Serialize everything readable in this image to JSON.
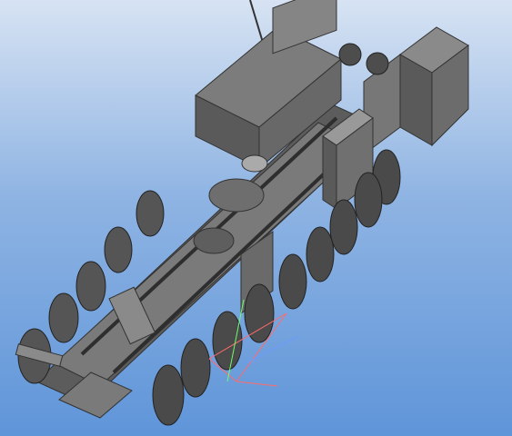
{
  "viewport": {
    "background_top": "#d7e3f3",
    "background_bottom": "#5f95d9"
  },
  "model": {
    "body_color": "#6e6e6e",
    "dark_color": "#3d3d3d",
    "light_color": "#b5b5b5",
    "tire_color": "#4a4a4a"
  },
  "axes_triad": {
    "x_color": "#ff6b6b",
    "y_color": "#6bff6b",
    "z_color": "#6b9bff"
  }
}
